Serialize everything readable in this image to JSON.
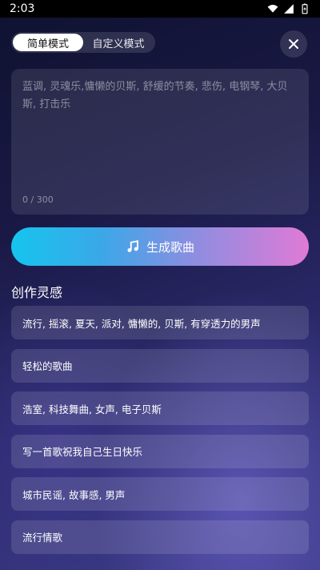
{
  "status_bar": {
    "time": "2:03"
  },
  "mode_toggle": {
    "simple_label": "简单模式",
    "custom_label": "自定义模式"
  },
  "prompt": {
    "placeholder": "蓝调, 灵魂乐,慵懒的贝斯, 舒缓的节奏, 悲伤, 电钢琴, 大贝斯, 打击乐",
    "counter": "0 / 300"
  },
  "generate_button": {
    "label": "生成歌曲"
  },
  "inspiration": {
    "title": "创作灵感",
    "items": [
      "流行, 摇滚, 夏天, 派对, 慵懒的, 贝斯, 有穿透力的男声",
      "轻松的歌曲",
      "浩室, 科技舞曲, 女声, 电子贝斯",
      "写一首歌祝我自己生日快乐",
      "城市民谣, 故事感, 男声",
      "流行情歌"
    ]
  },
  "colors": {
    "button_gradient_start": "#16c4ee",
    "button_gradient_end": "#e07ad6",
    "background": "#1a1946"
  },
  "icons": [
    "wifi-icon",
    "signal-icon",
    "battery-icon",
    "close-icon",
    "music-note-icon"
  ]
}
